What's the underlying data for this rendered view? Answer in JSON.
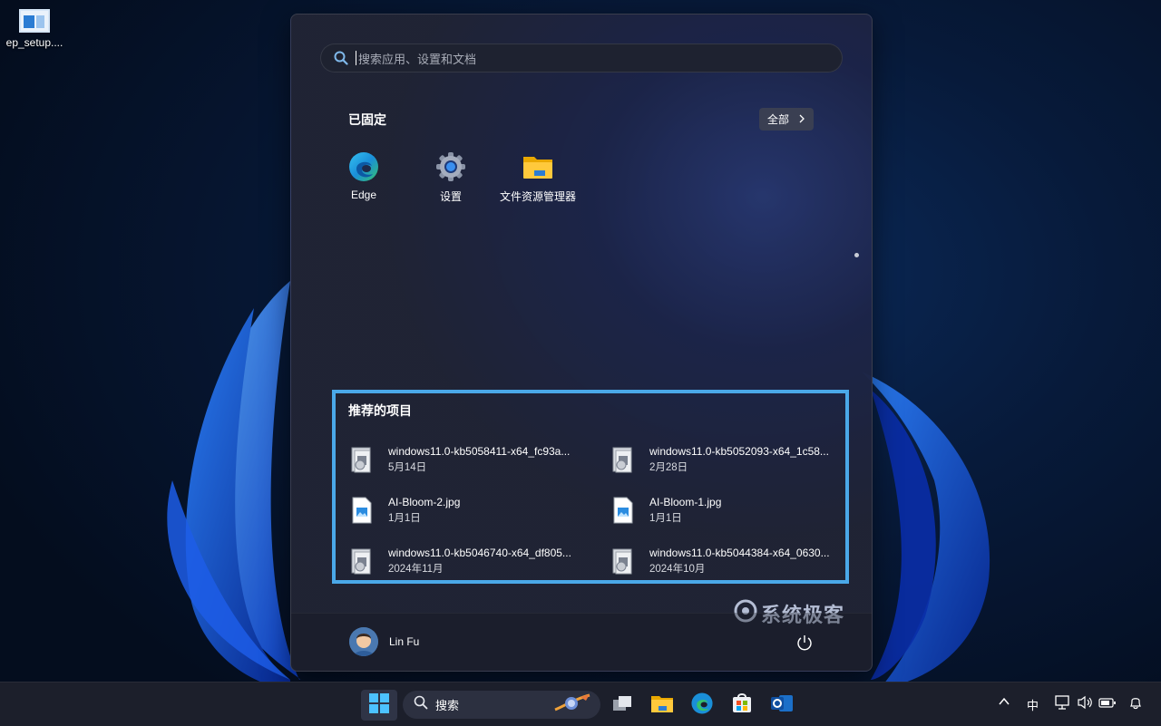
{
  "desktop": {
    "icons": [
      {
        "label": "ep_setup....",
        "icon": "setup-file-icon"
      }
    ]
  },
  "start": {
    "search_placeholder": "搜索应用、设置和文档",
    "pinned_title": "已固定",
    "all_button": "全部",
    "apps": [
      {
        "label": "Edge",
        "icon": "edge-icon"
      },
      {
        "label": "设置",
        "icon": "settings-gear-icon"
      },
      {
        "label": "文件资源管理器",
        "icon": "folder-icon"
      }
    ],
    "recommended_title": "推荐的项目",
    "recommended": [
      {
        "name": "windows11.0-kb5058411-x64_fc93a...",
        "date": "5月14日",
        "icon": "installer-package-icon"
      },
      {
        "name": "windows11.0-kb5052093-x64_1c58...",
        "date": "2月28日",
        "icon": "installer-package-icon"
      },
      {
        "name": "AI-Bloom-2.jpg",
        "date": "1月1日",
        "icon": "image-file-icon"
      },
      {
        "name": "AI-Bloom-1.jpg",
        "date": "1月1日",
        "icon": "image-file-icon"
      },
      {
        "name": "windows11.0-kb5046740-x64_df805...",
        "date": "2024年11月",
        "icon": "installer-package-icon"
      },
      {
        "name": "windows11.0-kb5044384-x64_0630...",
        "date": "2024年10月",
        "icon": "installer-package-icon"
      }
    ],
    "user_name": "Lin Fu",
    "watermark": "系统极客"
  },
  "taskbar": {
    "search_label": "搜索",
    "ime": "中",
    "colors": {
      "accent": "#4aa8e8",
      "taskbar": "#1c1f2b"
    }
  }
}
